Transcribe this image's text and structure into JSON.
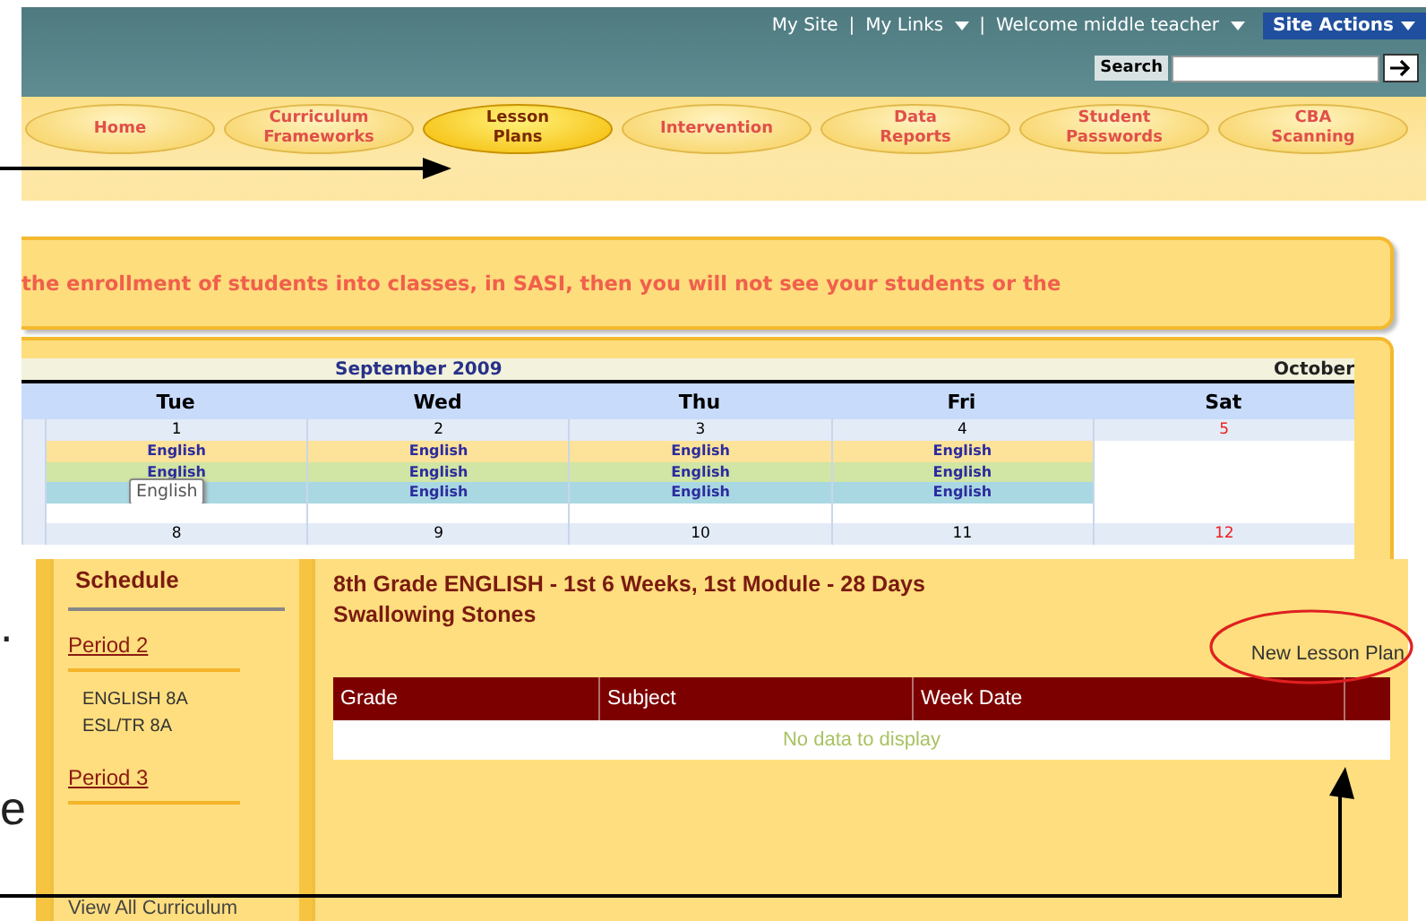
{
  "top_links": [
    {
      "kind": "link",
      "label": "My Site",
      "dropdown": false
    },
    {
      "kind": "separator",
      "label": "|"
    },
    {
      "kind": "link",
      "label": "My Links",
      "dropdown": true
    },
    {
      "kind": "separator",
      "label": "|"
    },
    {
      "kind": "link",
      "label": "Welcome middle teacher",
      "dropdown": true
    }
  ],
  "site_actions": "Site Actions",
  "search": {
    "label": "Search"
  },
  "nav_tabs": [
    {
      "label": "Home",
      "selected": false
    },
    {
      "label": "Curriculum\nFrameworks",
      "selected": false
    },
    {
      "label": "Lesson\nPlans",
      "selected": true
    },
    {
      "label": "Intervention",
      "selected": false
    },
    {
      "label": "Data\nReports",
      "selected": false
    },
    {
      "label": "Student\nPasswords",
      "selected": false
    },
    {
      "label": "CBA\nScanning",
      "selected": false
    }
  ],
  "notice": "the enrollment of students into classes, in SASI, then you will not see your students or the",
  "calendar": {
    "month": "September 2009",
    "next_month": "October",
    "columns": [
      "Tue",
      "Wed",
      "Thu",
      "Fri",
      "Sat"
    ],
    "weeks": [
      {
        "days": [
          {
            "number": "1",
            "weekend": false,
            "entries": [
              {
                "text": "English",
                "color": "#fde29a"
              },
              {
                "text": "English",
                "color": "#d1e5a4"
              },
              {
                "color": "#a9d8e3",
                "tooltip": "English"
              }
            ]
          },
          {
            "number": "2",
            "weekend": false,
            "entries": [
              {
                "text": "English",
                "color": "#fde29a"
              },
              {
                "text": "English",
                "color": "#d1e5a4"
              },
              {
                "text": "English",
                "color": "#a9d8e3"
              }
            ]
          },
          {
            "number": "3",
            "weekend": false,
            "entries": [
              {
                "text": "English",
                "color": "#fde29a"
              },
              {
                "text": "English",
                "color": "#d1e5a4"
              },
              {
                "text": "English",
                "color": "#a9d8e3"
              }
            ]
          },
          {
            "number": "4",
            "weekend": false,
            "entries": [
              {
                "text": "English",
                "color": "#fde29a"
              },
              {
                "text": "English",
                "color": "#d1e5a4"
              },
              {
                "text": "English",
                "color": "#a9d8e3"
              }
            ]
          },
          {
            "number": "5",
            "weekend": true
          }
        ]
      },
      {
        "days": [
          {
            "number": "8",
            "weekend": false
          },
          {
            "number": "9",
            "weekend": false
          },
          {
            "number": "10",
            "weekend": false
          },
          {
            "number": "11",
            "weekend": false
          },
          {
            "number": "12",
            "weekend": true
          }
        ]
      }
    ]
  },
  "schedule": {
    "title": "Schedule",
    "periods": [
      {
        "label": "Period 2",
        "classes": [
          "ENGLISH 8A",
          "ESL/TR 8A"
        ]
      },
      {
        "label": "Period 3"
      }
    ],
    "view_all": "View All Curriculum"
  },
  "lesson": {
    "title": "8th Grade ENGLISH - 1st 6 Weeks, 1st Module - 28 Days",
    "subtitle": "Swallowing Stones",
    "new_button": "New Lesson Plan",
    "columns": [
      "Grade",
      "Subject",
      "Week Date"
    ],
    "empty": "No data to display"
  },
  "doc_fragments": [
    ".",
    "e"
  ]
}
